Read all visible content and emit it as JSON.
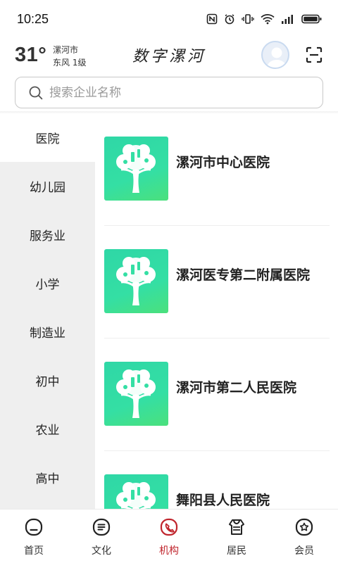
{
  "status_bar": {
    "time": "10:25"
  },
  "header": {
    "temperature": "31°",
    "city": "漯河市",
    "wind": "东风  1级",
    "brand_title": "数字漯河"
  },
  "search": {
    "placeholder": "搜索企业名称"
  },
  "sidebar": {
    "items": [
      {
        "label": "医院",
        "active": true
      },
      {
        "label": "幼儿园"
      },
      {
        "label": "服务业"
      },
      {
        "label": "小学"
      },
      {
        "label": "制造业"
      },
      {
        "label": "初中"
      },
      {
        "label": "农业"
      },
      {
        "label": "高中"
      }
    ]
  },
  "list": {
    "items": [
      {
        "name": "漯河市中心医院"
      },
      {
        "name": "漯河医专第二附属医院"
      },
      {
        "name": "漯河市第二人民医院"
      },
      {
        "name": "舞阳县人民医院"
      }
    ]
  },
  "bottom_nav": {
    "items": [
      {
        "label": "首页",
        "icon": "home-icon"
      },
      {
        "label": "文化",
        "icon": "culture-icon"
      },
      {
        "label": "机构",
        "icon": "institution-icon",
        "active": true
      },
      {
        "label": "居民",
        "icon": "resident-icon"
      },
      {
        "label": "会员",
        "icon": "member-icon"
      }
    ]
  },
  "colors": {
    "accent": "#c0252d",
    "thumb_green": "#34dfa4",
    "sidebar_bg": "#efefef"
  }
}
